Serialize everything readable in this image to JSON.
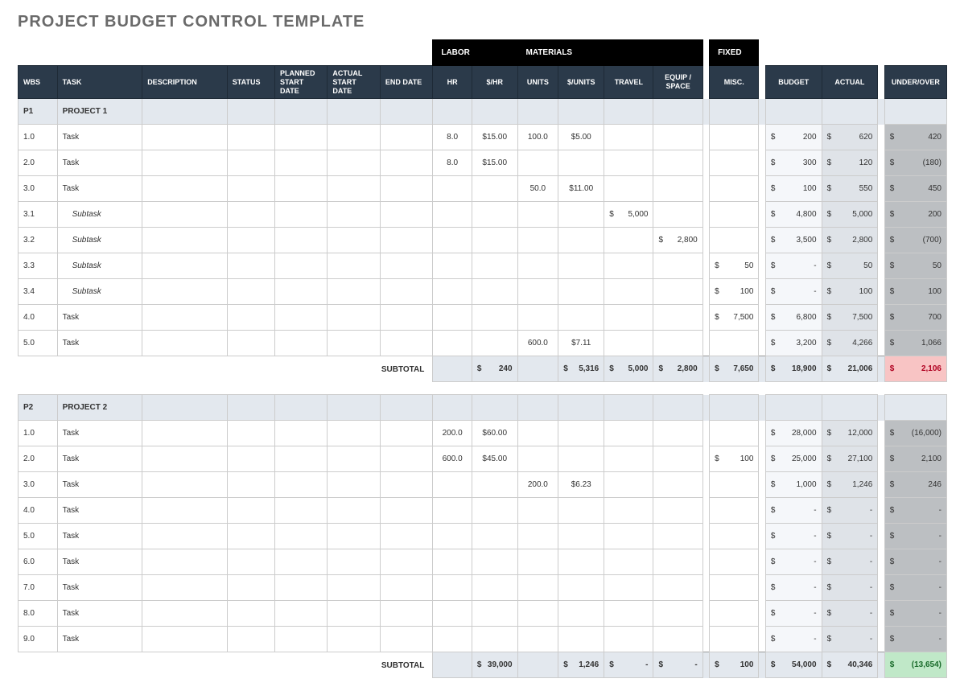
{
  "title": "PROJECT BUDGET CONTROL TEMPLATE",
  "sections": {
    "labor": "LABOR",
    "materials": "MATERIALS",
    "fixed": "FIXED"
  },
  "headers": {
    "wbs": "WBS",
    "task": "TASK",
    "description": "DESCRIPTION",
    "status": "STATUS",
    "pstart": "PLANNED START DATE",
    "astart": "ACTUAL START DATE",
    "end": "END DATE",
    "hr": "HR",
    "rate": "$/HR",
    "units": "UNITS",
    "urate": "$/UNITS",
    "travel": "TRAVEL",
    "equip": "EQUIP / SPACE",
    "misc": "MISC.",
    "budget": "BUDGET",
    "actual": "ACTUAL",
    "uo": "UNDER/OVER"
  },
  "subtotal_label": "SUBTOTAL",
  "projects": [
    {
      "code": "P1",
      "name": "PROJECT 1",
      "rows": [
        {
          "wbs": "1.0",
          "task": "Task",
          "hr": "8.0",
          "rate": "$15.00",
          "units": "100.0",
          "urate": "$5.00",
          "budget": "200",
          "actual": "620",
          "uo": "420"
        },
        {
          "wbs": "2.0",
          "task": "Task",
          "hr": "8.0",
          "rate": "$15.00",
          "budget": "300",
          "actual": "120",
          "uo": "(180)"
        },
        {
          "wbs": "3.0",
          "task": "Task",
          "units": "50.0",
          "urate": "$11.00",
          "budget": "100",
          "actual": "550",
          "uo": "450"
        },
        {
          "wbs": "3.1",
          "task": "Subtask",
          "indent": true,
          "travel": "5,000",
          "budget": "4,800",
          "actual": "5,000",
          "uo": "200"
        },
        {
          "wbs": "3.2",
          "task": "Subtask",
          "indent": true,
          "equip": "2,800",
          "budget": "3,500",
          "actual": "2,800",
          "uo": "(700)"
        },
        {
          "wbs": "3.3",
          "task": "Subtask",
          "indent": true,
          "misc": "50",
          "budget": "-",
          "actual": "50",
          "uo": "50"
        },
        {
          "wbs": "3.4",
          "task": "Subtask",
          "indent": true,
          "misc": "100",
          "budget": "-",
          "actual": "100",
          "uo": "100"
        },
        {
          "wbs": "4.0",
          "task": "Task",
          "misc": "7,500",
          "budget": "6,800",
          "actual": "7,500",
          "uo": "700"
        },
        {
          "wbs": "5.0",
          "task": "Task",
          "units": "600.0",
          "urate": "$7.11",
          "budget": "3,200",
          "actual": "4,266",
          "uo": "1,066"
        }
      ],
      "subtotal": {
        "labor": "240",
        "materials": "5,316",
        "travel": "5,000",
        "equip": "2,800",
        "misc": "7,650",
        "budget": "18,900",
        "actual": "21,006",
        "uo": "2,106",
        "uo_class": "neg"
      }
    },
    {
      "code": "P2",
      "name": "PROJECT 2",
      "rows": [
        {
          "wbs": "1.0",
          "task": "Task",
          "hr": "200.0",
          "rate": "$60.00",
          "budget": "28,000",
          "actual": "12,000",
          "uo": "(16,000)"
        },
        {
          "wbs": "2.0",
          "task": "Task",
          "hr": "600.0",
          "rate": "$45.00",
          "misc": "100",
          "budget": "25,000",
          "actual": "27,100",
          "uo": "2,100"
        },
        {
          "wbs": "3.0",
          "task": "Task",
          "units": "200.0",
          "urate": "$6.23",
          "budget": "1,000",
          "actual": "1,246",
          "uo": "246"
        },
        {
          "wbs": "4.0",
          "task": "Task",
          "budget": "-",
          "actual": "-",
          "uo": "-"
        },
        {
          "wbs": "5.0",
          "task": "Task",
          "budget": "-",
          "actual": "-",
          "uo": "-"
        },
        {
          "wbs": "6.0",
          "task": "Task",
          "budget": "-",
          "actual": "-",
          "uo": "-"
        },
        {
          "wbs": "7.0",
          "task": "Task",
          "budget": "-",
          "actual": "-",
          "uo": "-"
        },
        {
          "wbs": "8.0",
          "task": "Task",
          "budget": "-",
          "actual": "-",
          "uo": "-"
        },
        {
          "wbs": "9.0",
          "task": "Task",
          "budget": "-",
          "actual": "-",
          "uo": "-"
        }
      ],
      "subtotal": {
        "labor": "39,000",
        "materials": "1,246",
        "travel": "-",
        "equip": "-",
        "misc": "100",
        "budget": "54,000",
        "actual": "40,346",
        "uo": "(13,654)",
        "uo_class": "pos"
      }
    }
  ]
}
